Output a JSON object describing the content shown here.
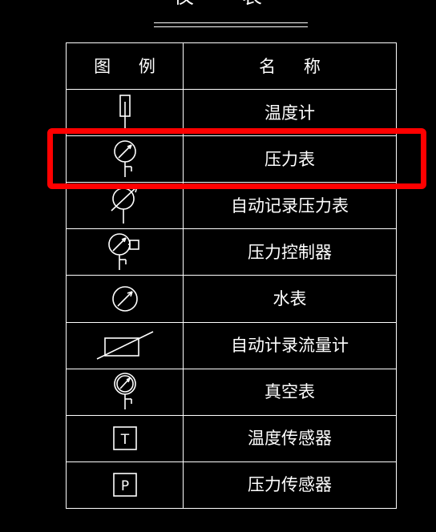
{
  "document": {
    "title": "仪    表",
    "title_note": "标题被视口上边缘裁切（仅显示下半部笔画）",
    "background_color": "#000000",
    "line_color": "#ffffff"
  },
  "table": {
    "name": "图例名称对照表",
    "columns": [
      {
        "key": "symbol",
        "label": "图  例"
      },
      {
        "key": "name",
        "label": "名  称"
      }
    ],
    "rows": [
      {
        "symbol_icon": "thermometer-symbol",
        "name": "温度计"
      },
      {
        "symbol_icon": "pressure-gauge-symbol",
        "name": "压力表"
      },
      {
        "symbol_icon": "recording-pressure-gauge-symbol",
        "name": "自动记录压力表"
      },
      {
        "symbol_icon": "pressure-controller-symbol",
        "name": "压力控制器"
      },
      {
        "symbol_icon": "water-meter-symbol",
        "name": "水表"
      },
      {
        "symbol_icon": "recording-flow-meter-symbol",
        "name": "自动计录流量计"
      },
      {
        "symbol_icon": "vacuum-gauge-symbol",
        "name": "真空表"
      },
      {
        "symbol_icon": "temperature-sensor-symbol",
        "name": "温度传感器",
        "symbol_letter": "T"
      },
      {
        "symbol_icon": "pressure-sensor-symbol",
        "name": "压力传感器",
        "symbol_letter": "P"
      }
    ]
  },
  "annotation": {
    "name": "红色高亮框",
    "target_row_index": 1,
    "target_row_name": "压力表",
    "color": "#ff0000",
    "border_width_px": 7,
    "shape": "rounded-rectangle"
  }
}
